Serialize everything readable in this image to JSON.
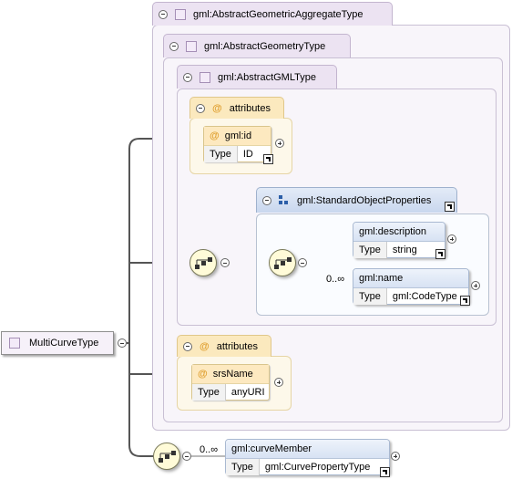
{
  "root": {
    "name": "MultiCurveType"
  },
  "types": [
    {
      "name": "gml:AbstractGeometricAggregateType"
    },
    {
      "name": "gml:AbstractGeometryType"
    },
    {
      "name": "gml:AbstractGMLType"
    }
  ],
  "attribute_groups": [
    {
      "label": "attributes",
      "attribute": {
        "name": "gml:id",
        "type_label": "Type",
        "type": "ID"
      }
    },
    {
      "label": "attributes",
      "attribute": {
        "name": "srsName",
        "type_label": "Type",
        "type": "anyURI"
      }
    }
  ],
  "standard_object_properties": {
    "name": "gml:StandardObjectProperties",
    "elements": [
      {
        "name": "gml:description",
        "type_label": "Type",
        "type": "string",
        "occurrence": ""
      },
      {
        "name": "gml:name",
        "type_label": "Type",
        "type": "gml:CodeType",
        "occurrence": "0..∞"
      }
    ]
  },
  "curve_member": {
    "name": "gml:curveMember",
    "type_label": "Type",
    "type": "gml:CurvePropertyType",
    "occurrence": "0..∞"
  },
  "icons": {
    "collapse": "minus-circle-icon",
    "expand": "plus-circle-icon",
    "sequence": "sequence-compositor-icon",
    "link": "go-to-definition-icon",
    "complex_type": "complex-type-square-icon",
    "group": "group-icon"
  },
  "colors": {
    "type_container": "#f8f5fa",
    "attribute_header": "#fbe9be",
    "element_header": "#d7e2f3",
    "sequence": "#fffbd8"
  }
}
